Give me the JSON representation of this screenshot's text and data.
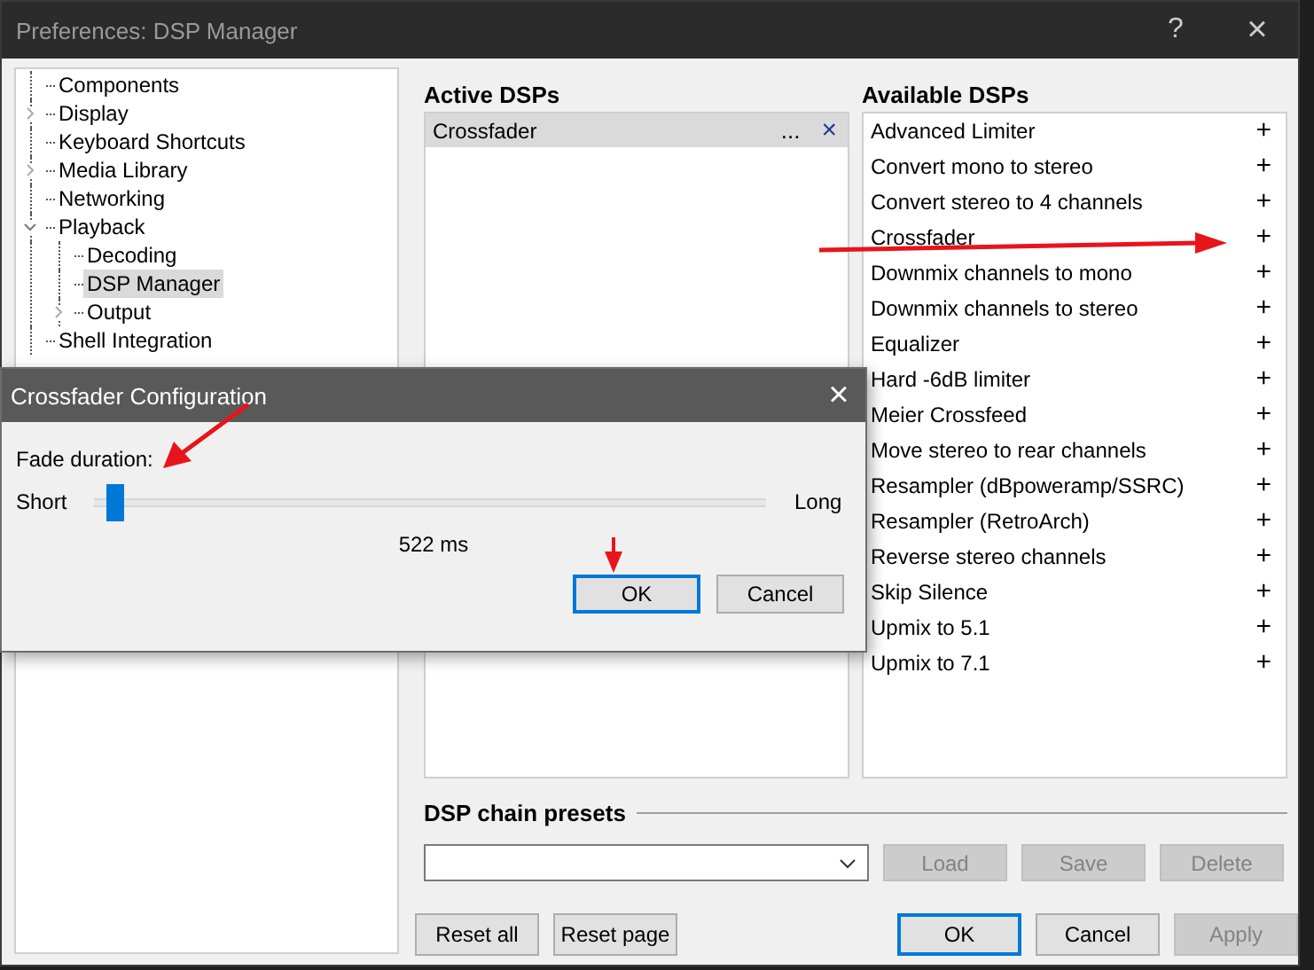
{
  "window": {
    "title": "Preferences: DSP Manager",
    "help": "?",
    "close": "×"
  },
  "tree": [
    {
      "label": "Components",
      "selected": false
    },
    {
      "label": "Display",
      "expanded": false,
      "selected": false
    },
    {
      "label": "Keyboard Shortcuts",
      "selected": false
    },
    {
      "label": "Media Library",
      "expanded": false,
      "selected": false
    },
    {
      "label": "Networking",
      "selected": false
    },
    {
      "label": "Playback",
      "expanded": true,
      "selected": false,
      "children": [
        {
          "label": "Decoding",
          "selected": false
        },
        {
          "label": "DSP Manager",
          "selected": true
        },
        {
          "label": "Output",
          "expanded": false,
          "selected": false
        }
      ]
    },
    {
      "label": "Shell Integration",
      "selected": false
    }
  ],
  "active_dsps": {
    "title": "Active DSPs",
    "items": [
      {
        "label": "Crossfader",
        "selected": true,
        "configure": "...",
        "remove": "×"
      }
    ]
  },
  "available_dsps": {
    "title": "Available DSPs",
    "items": [
      {
        "label": "Advanced Limiter",
        "add": "+"
      },
      {
        "label": "Convert mono to stereo",
        "add": "+"
      },
      {
        "label": "Convert stereo to 4 channels",
        "add": "+"
      },
      {
        "label": "Crossfader",
        "add": "+"
      },
      {
        "label": "Downmix channels to mono",
        "add": "+"
      },
      {
        "label": "Downmix channels to stereo",
        "add": "+"
      },
      {
        "label": "Equalizer",
        "add": "+"
      },
      {
        "label": "Hard -6dB limiter",
        "add": "+"
      },
      {
        "label": "Meier Crossfeed",
        "add": "+"
      },
      {
        "label": "Move stereo to rear channels",
        "add": "+"
      },
      {
        "label": "Resampler (dBpoweramp/SSRC)",
        "add": "+"
      },
      {
        "label": "Resampler (RetroArch)",
        "add": "+"
      },
      {
        "label": "Reverse stereo channels",
        "add": "+"
      },
      {
        "label": "Skip Silence",
        "add": "+"
      },
      {
        "label": "Upmix to 5.1",
        "add": "+"
      },
      {
        "label": "Upmix to 7.1",
        "add": "+"
      }
    ]
  },
  "presets": {
    "title": "DSP chain presets",
    "buttons": [
      {
        "label": "Load",
        "disabled": true
      },
      {
        "label": "Save",
        "disabled": true
      },
      {
        "label": "Delete",
        "disabled": true
      }
    ]
  },
  "footer_left": [
    {
      "label": "Reset all",
      "default": false,
      "disabled": false
    },
    {
      "label": "Reset page",
      "default": false,
      "disabled": false
    }
  ],
  "footer_right": [
    {
      "label": "OK",
      "default": true,
      "disabled": false
    },
    {
      "label": "Cancel",
      "default": false,
      "disabled": false
    },
    {
      "label": "Apply",
      "default": false,
      "disabled": true
    }
  ],
  "dialog": {
    "title": "Crossfader Configuration",
    "close": "×",
    "label": "Fade duration:",
    "min_label": "Short",
    "max_label": "Long",
    "level": 0.02,
    "reading": "522 ms",
    "buttons": [
      {
        "label": "OK",
        "default": true,
        "disabled": false
      },
      {
        "label": "Cancel",
        "default": false,
        "disabled": false
      }
    ]
  }
}
